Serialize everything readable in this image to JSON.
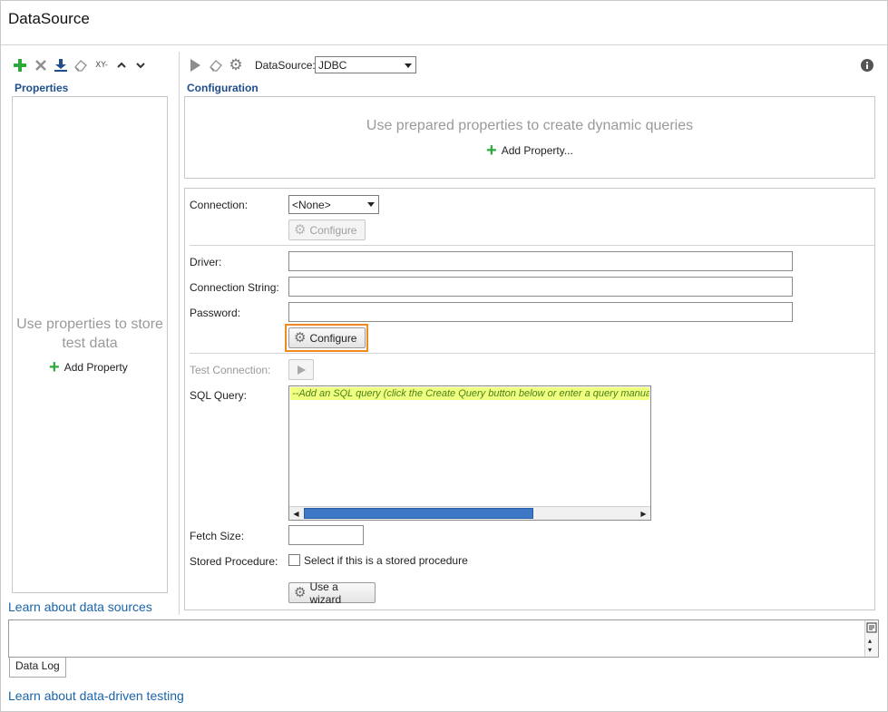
{
  "window": {
    "title": "DataSource"
  },
  "left_toolbar": {
    "icons": [
      "plus-icon",
      "delete-icon",
      "download-icon",
      "eraser-icon",
      "xy-icon",
      "chevron-up-icon",
      "chevron-down-icon"
    ],
    "xy_label": "XY-"
  },
  "properties": {
    "heading": "Properties",
    "empty_hint": "Use properties to store test data",
    "add_label": "Add Property"
  },
  "right_toolbar": {
    "datasource_label": "DataSource:",
    "datasource_value": "JDBC"
  },
  "configuration": {
    "heading": "Configuration",
    "hint": "Use prepared properties to create dynamic queries",
    "add_label": "Add Property..."
  },
  "form": {
    "connection_label": "Connection:",
    "connection_value": "<None>",
    "configure_label": "Configure",
    "driver_label": "Driver:",
    "driver_value": "",
    "connection_string_label": "Connection String:",
    "connection_string_value": "",
    "password_label": "Password:",
    "password_value": "",
    "configure2_label": "Configure",
    "test_connection_label": "Test Connection:",
    "sql_query_label": "SQL Query:",
    "sql_query_value": "--Add an SQL query (click the Create Query button below or enter a query manua",
    "fetch_size_label": "Fetch Size:",
    "fetch_size_value": "",
    "stored_procedure_label": "Stored Procedure:",
    "stored_procedure_checkbox": "Select if this is a stored procedure",
    "wizard_label": "Use a wizard"
  },
  "links": {
    "learn_datasources": "Learn about data sources",
    "learn_ddt": "Learn about data-driven testing"
  },
  "log": {
    "tab_label": "Data Log"
  },
  "colors": {
    "accent": "#1f4e8c",
    "link": "#1b64a8",
    "highlight": "#f08a1e",
    "add": "#2eaa3c"
  }
}
